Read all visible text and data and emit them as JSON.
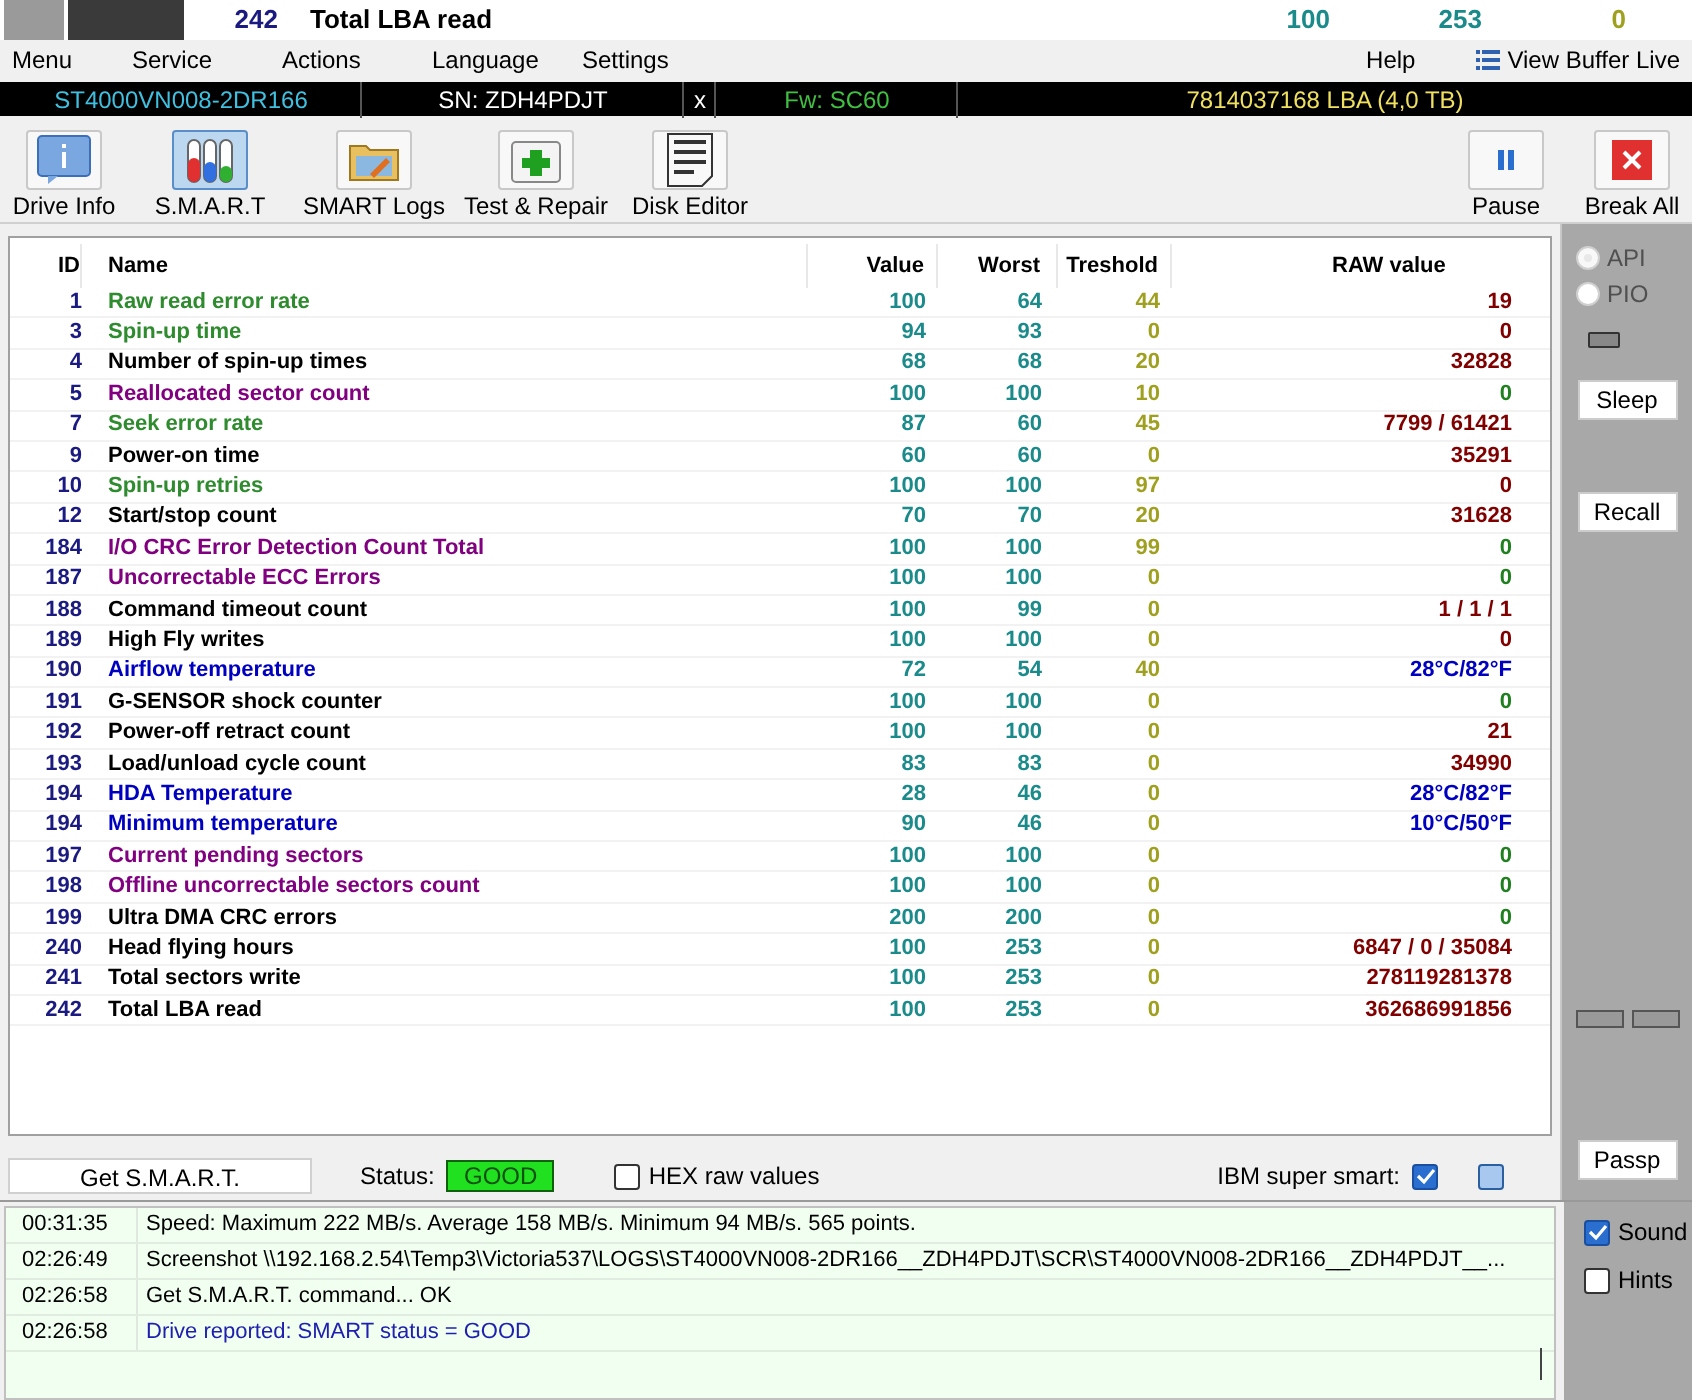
{
  "background_row": {
    "id": "242",
    "name": "Total LBA read",
    "value": "100",
    "worst": "253",
    "threshold": "0"
  },
  "menu": [
    "Menu",
    "Service",
    "Actions",
    "Language",
    "Settings"
  ],
  "menu_right": {
    "help": "Help",
    "view_buffer": "View Buffer Live"
  },
  "drive_bar": {
    "model": "ST4000VN008-2DR166",
    "serial": "SN: ZDH4PDJT",
    "close": "x",
    "firmware": "Fw: SC60",
    "capacity": "7814037168 LBA (4,0 TB)"
  },
  "toolbar": [
    {
      "label": "Drive Info",
      "kind": "info",
      "selected": false
    },
    {
      "label": "S.M.A.R.T",
      "kind": "smart",
      "selected": true
    },
    {
      "label": "SMART Logs",
      "kind": "logs",
      "selected": false
    },
    {
      "label": "Test & Repair",
      "kind": "repair",
      "selected": false
    },
    {
      "label": "Disk Editor",
      "kind": "editor",
      "selected": false
    }
  ],
  "toolbar_right": [
    {
      "label": "Pause",
      "kind": "pause"
    },
    {
      "label": "Break All",
      "kind": "break"
    }
  ],
  "table": {
    "columns": [
      "ID",
      "Name",
      "Value",
      "Worst",
      "Treshold",
      "RAW value"
    ],
    "rows": [
      {
        "id": "1",
        "name": "Raw read error rate",
        "color": "#2e8b2e",
        "value": "100",
        "worst": "64",
        "threshold": "44",
        "raw": "19",
        "kind": "count"
      },
      {
        "id": "3",
        "name": "Spin-up time",
        "color": "#2e8b2e",
        "value": "94",
        "worst": "93",
        "threshold": "0",
        "raw": "0",
        "kind": "count"
      },
      {
        "id": "4",
        "name": "Number of spin-up times",
        "color": "#000000",
        "value": "68",
        "worst": "68",
        "threshold": "20",
        "raw": "32828",
        "kind": "count"
      },
      {
        "id": "5",
        "name": "Reallocated sector count",
        "color": "#800080",
        "value": "100",
        "worst": "100",
        "threshold": "10",
        "raw": "0",
        "kind": "zero"
      },
      {
        "id": "7",
        "name": "Seek error rate",
        "color": "#2e8b2e",
        "value": "87",
        "worst": "60",
        "threshold": "45",
        "raw": "7799 / 61421",
        "kind": "count"
      },
      {
        "id": "9",
        "name": "Power-on time",
        "color": "#000000",
        "value": "60",
        "worst": "60",
        "threshold": "0",
        "raw": "35291",
        "kind": "count"
      },
      {
        "id": "10",
        "name": "Spin-up retries",
        "color": "#2e8b2e",
        "value": "100",
        "worst": "100",
        "threshold": "97",
        "raw": "0",
        "kind": "count"
      },
      {
        "id": "12",
        "name": "Start/stop count",
        "color": "#000000",
        "value": "70",
        "worst": "70",
        "threshold": "20",
        "raw": "31628",
        "kind": "count"
      },
      {
        "id": "184",
        "name": "I/O CRC Error Detection Count Total",
        "color": "#800080",
        "value": "100",
        "worst": "100",
        "threshold": "99",
        "raw": "0",
        "kind": "zero"
      },
      {
        "id": "187",
        "name": "Uncorrectable ECC Errors",
        "color": "#800080",
        "value": "100",
        "worst": "100",
        "threshold": "0",
        "raw": "0",
        "kind": "zero"
      },
      {
        "id": "188",
        "name": "Command timeout count",
        "color": "#000000",
        "value": "100",
        "worst": "99",
        "threshold": "0",
        "raw": "1 / 1 / 1",
        "kind": "count"
      },
      {
        "id": "189",
        "name": "High Fly writes",
        "color": "#000000",
        "value": "100",
        "worst": "100",
        "threshold": "0",
        "raw": "0",
        "kind": "count"
      },
      {
        "id": "190",
        "name": "Airflow temperature",
        "color": "#0000c0",
        "value": "72",
        "worst": "54",
        "threshold": "40",
        "raw": "28°C/82°F",
        "kind": "temperature"
      },
      {
        "id": "191",
        "name": "G-SENSOR shock counter",
        "color": "#000000",
        "value": "100",
        "worst": "100",
        "threshold": "0",
        "raw": "0",
        "kind": "zero"
      },
      {
        "id": "192",
        "name": "Power-off retract count",
        "color": "#000000",
        "value": "100",
        "worst": "100",
        "threshold": "0",
        "raw": "21",
        "kind": "count"
      },
      {
        "id": "193",
        "name": "Load/unload cycle count",
        "color": "#000000",
        "value": "83",
        "worst": "83",
        "threshold": "0",
        "raw": "34990",
        "kind": "count"
      },
      {
        "id": "194",
        "name": "HDA Temperature",
        "color": "#0000c0",
        "value": "28",
        "worst": "46",
        "threshold": "0",
        "raw": "28°C/82°F",
        "kind": "temperature"
      },
      {
        "id": "194",
        "name": "Minimum temperature",
        "color": "#0000c0",
        "value": "90",
        "worst": "46",
        "threshold": "0",
        "raw": "10°C/50°F",
        "kind": "temperature"
      },
      {
        "id": "197",
        "name": "Current pending sectors",
        "color": "#800080",
        "value": "100",
        "worst": "100",
        "threshold": "0",
        "raw": "0",
        "kind": "zero"
      },
      {
        "id": "198",
        "name": "Offline uncorrectable sectors count",
        "color": "#800080",
        "value": "100",
        "worst": "100",
        "threshold": "0",
        "raw": "0",
        "kind": "zero"
      },
      {
        "id": "199",
        "name": "Ultra DMA CRC errors",
        "color": "#000000",
        "value": "200",
        "worst": "200",
        "threshold": "0",
        "raw": "0",
        "kind": "zero"
      },
      {
        "id": "240",
        "name": "Head flying hours",
        "color": "#000000",
        "value": "100",
        "worst": "253",
        "threshold": "0",
        "raw": "6847 / 0 / 35084",
        "kind": "count"
      },
      {
        "id": "241",
        "name": "Total sectors write",
        "color": "#000000",
        "value": "100",
        "worst": "253",
        "threshold": "0",
        "raw": "278119281378",
        "kind": "count"
      },
      {
        "id": "242",
        "name": "Total LBA read",
        "color": "#000000",
        "value": "100",
        "worst": "253",
        "threshold": "0",
        "raw": "362686991856",
        "kind": "count"
      }
    ]
  },
  "side_panel": {
    "api": {
      "label": "API",
      "selected": true,
      "disabled": true
    },
    "pio": {
      "label": "PIO",
      "selected": false,
      "disabled": true
    },
    "buttons": [
      "Sleep",
      "Recall"
    ],
    "passp": "Passp"
  },
  "status_row": {
    "get_smart": "Get S.M.A.R.T.",
    "status_label": "Status:",
    "status_value": "GOOD",
    "hex_raw": {
      "label": "HEX raw values",
      "checked": false
    },
    "ibm": {
      "label": "IBM super smart:",
      "checked": true
    },
    "extra_checked": false
  },
  "log": [
    {
      "time": "00:31:35",
      "message": "Speed: Maximum 222 MB/s. Average 158 MB/s. Minimum 94 MB/s. 565 points.",
      "kind": "normal"
    },
    {
      "time": "02:26:49",
      "message": "Screenshot \\\\192.168.2.54\\Temp3\\Victoria537\\LOGS\\ST4000VN008-2DR166__ZDH4PDJT\\SCR\\ST4000VN008-2DR166__ZDH4PDJT__...",
      "kind": "normal"
    },
    {
      "time": "02:26:58",
      "message": "Get S.M.A.R.T. command... OK",
      "kind": "normal"
    },
    {
      "time": "02:26:58",
      "message": "Drive reported: SMART status = GOOD",
      "kind": "info"
    }
  ],
  "log_options": [
    {
      "label": "Sound",
      "checked": true
    },
    {
      "label": "Hints",
      "checked": false
    }
  ]
}
